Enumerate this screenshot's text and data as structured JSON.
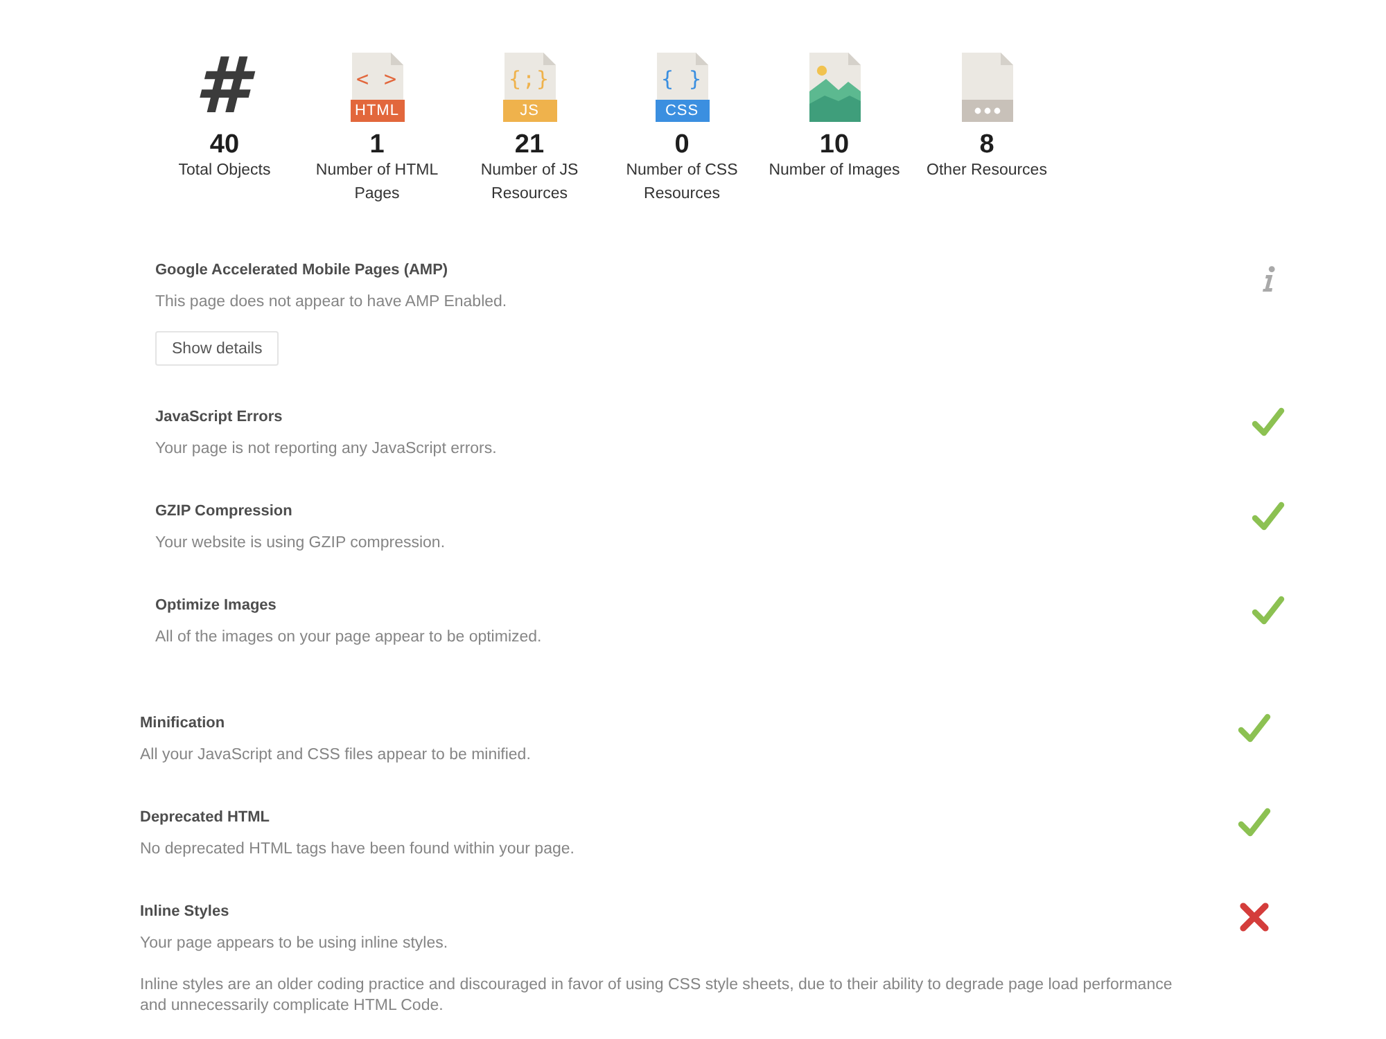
{
  "stats": [
    {
      "kind": "total",
      "symbol": "#",
      "value": "40",
      "label": "Total Objects"
    },
    {
      "kind": "file",
      "glyph": "< >",
      "badge": "HTML",
      "color": "#e2673c",
      "value": "1",
      "label": "Number of HTML Pages"
    },
    {
      "kind": "file",
      "glyph": "{;}",
      "badge": "JS",
      "color": "#efb24c",
      "value": "21",
      "label": "Number of JS Resources"
    },
    {
      "kind": "file",
      "glyph": "{ }",
      "badge": "CSS",
      "color": "#3b8fe0",
      "value": "0",
      "label": "Number of CSS Resources"
    },
    {
      "kind": "image",
      "value": "10",
      "label": "Number of Images"
    },
    {
      "kind": "other",
      "value": "8",
      "label": "Other Resources"
    }
  ],
  "sections": [
    {
      "checks": [
        {
          "title": "Google Accelerated Mobile Pages (AMP)",
          "description": "This page does not appear to have AMP Enabled.",
          "kind": "info",
          "button": "Show details"
        },
        {
          "title": "JavaScript Errors",
          "description": "Your page is not reporting any JavaScript errors.",
          "kind": "pass"
        },
        {
          "title": "GZIP Compression",
          "description": "Your website is using GZIP compression.",
          "kind": "pass"
        },
        {
          "title": "Optimize Images",
          "description": "All of the images on your page appear to be optimized.",
          "kind": "pass"
        }
      ]
    },
    {
      "checks": [
        {
          "title": "Minification",
          "description": "All your JavaScript and CSS files appear to be minified.",
          "kind": "pass"
        },
        {
          "title": "Deprecated HTML",
          "description": "No deprecated HTML tags have been found within your page.",
          "kind": "pass"
        },
        {
          "title": "Inline Styles",
          "description": "Your page appears to be using inline styles.",
          "kind": "fail",
          "details": "Inline styles are an older coding practice and discouraged in favor of using CSS style sheets, due to their ability to degrade page load performance and unnecessarily complicate HTML Code."
        }
      ]
    }
  ]
}
